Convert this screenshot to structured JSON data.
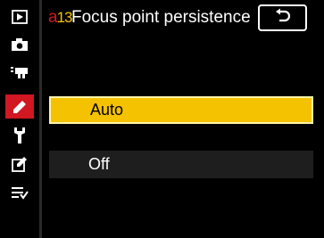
{
  "sidebar": {
    "items": [
      {
        "name": "playback-menu",
        "icon": "play-icon"
      },
      {
        "name": "photo-shooting-menu",
        "icon": "camera-icon"
      },
      {
        "name": "movie-shooting-menu",
        "icon": "movie-camera-icon"
      },
      {
        "name": "custom-settings-menu",
        "icon": "pencil-icon",
        "active": true
      },
      {
        "name": "setup-menu",
        "icon": "wrench-icon"
      },
      {
        "name": "retouch-menu",
        "icon": "retouch-icon"
      },
      {
        "name": "my-menu",
        "icon": "my-menu-icon"
      }
    ],
    "active_color": "#d01722"
  },
  "header": {
    "code_prefix": "a",
    "code_number": "13",
    "title": "Focus point persistence",
    "back_icon": "back-arrow-icon"
  },
  "options": [
    {
      "label": "Auto",
      "selected": true
    },
    {
      "label": "Off",
      "selected": false
    }
  ],
  "colors": {
    "selected_bg": "#f4c200",
    "unselected_bg": "#1e1e1e",
    "accent_red": "#d01722"
  }
}
